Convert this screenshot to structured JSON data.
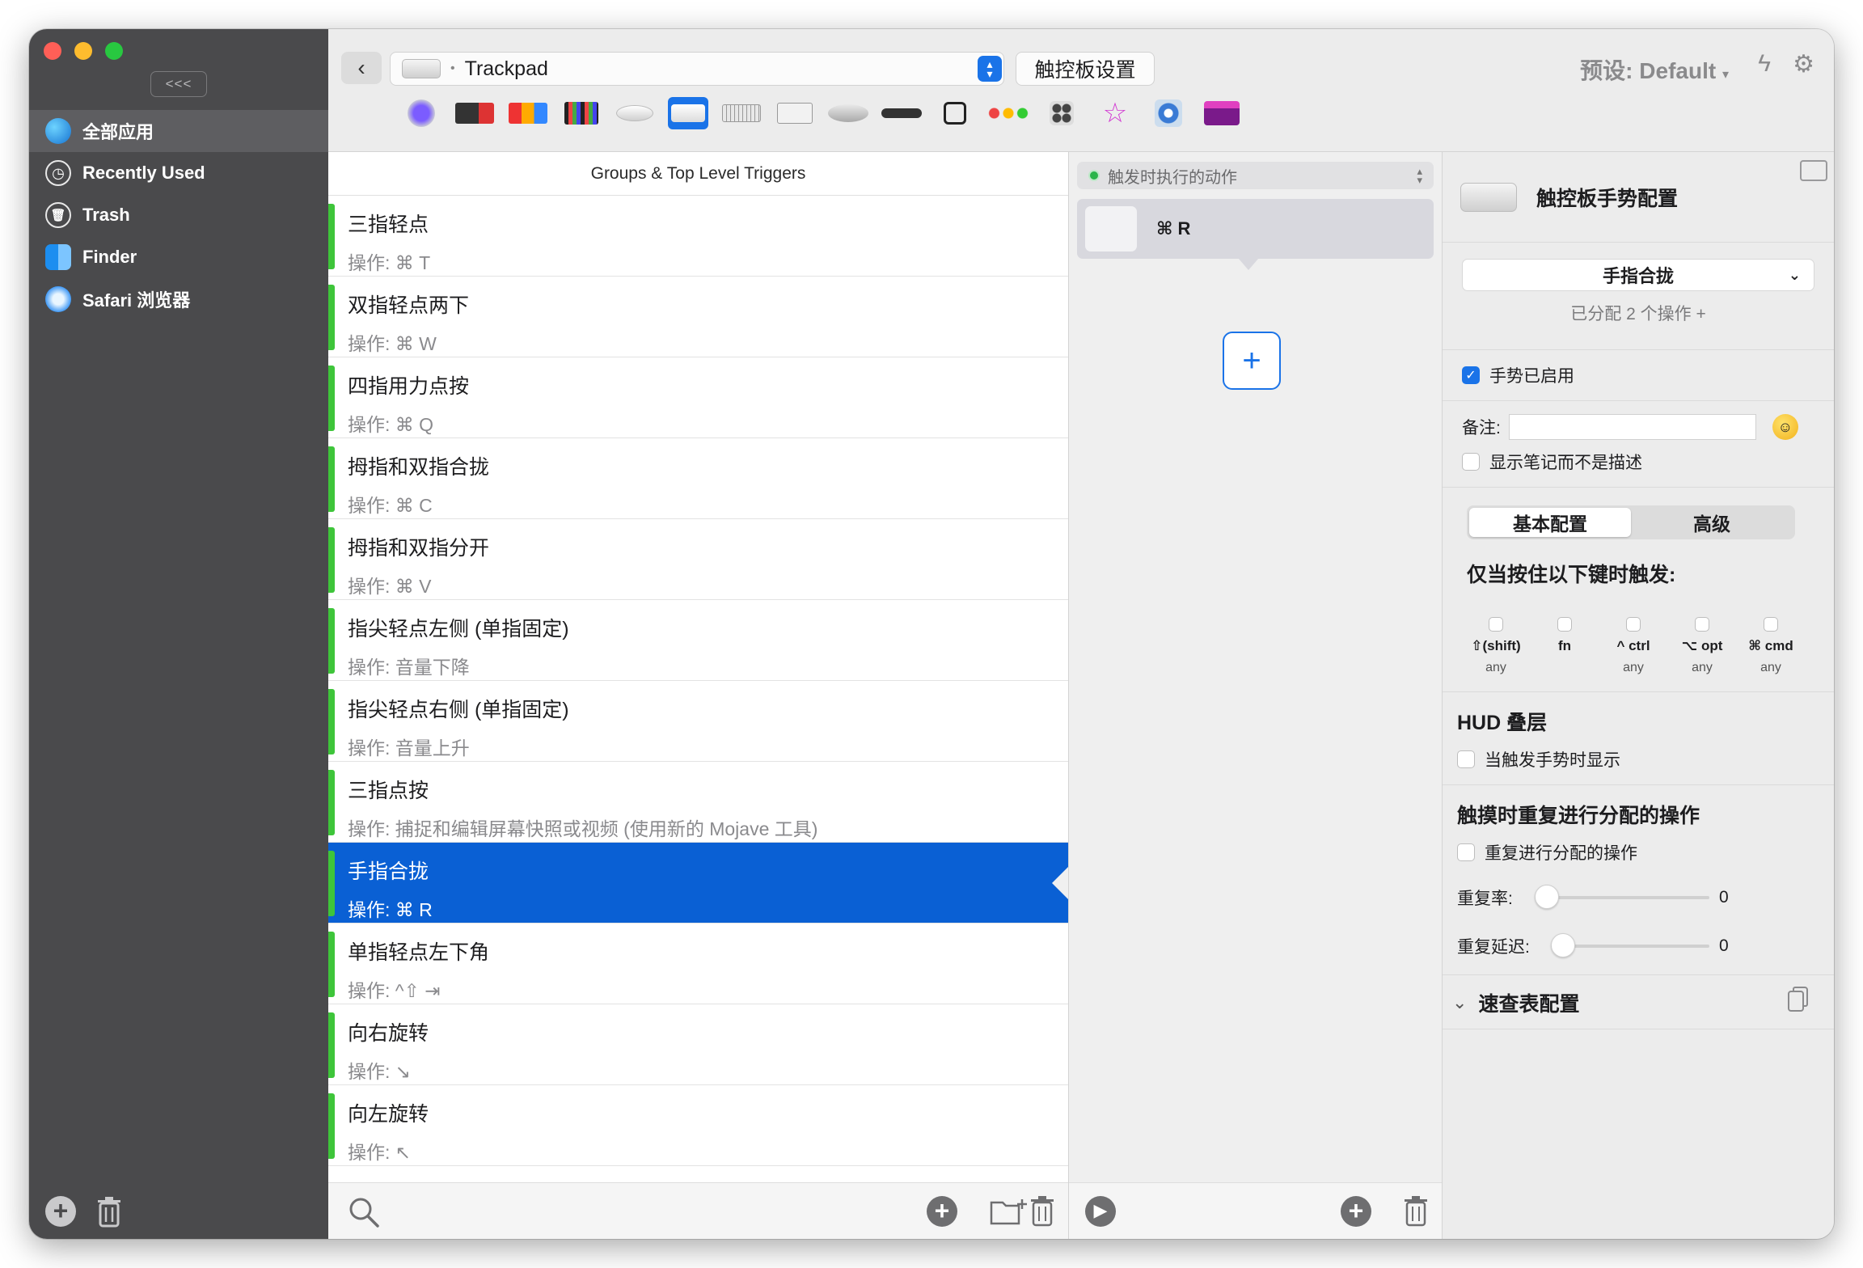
{
  "sidebar": {
    "collapse_label": "<<<",
    "items": [
      {
        "label": "全部应用",
        "icon": "globe-icon"
      },
      {
        "label": "Recently Used",
        "icon": "clock-icon"
      },
      {
        "label": "Trash",
        "icon": "trash-icon"
      },
      {
        "label": "Finder",
        "icon": "finder-icon"
      },
      {
        "label": "Safari 浏览器",
        "icon": "safari-icon"
      }
    ]
  },
  "toolbar": {
    "device_name": "Trackpad",
    "settings_button": "触控板设置",
    "preset_label": "预设: Default"
  },
  "list": {
    "header": "Groups & Top Level Triggers",
    "triggers": [
      {
        "title": "三指轻点",
        "sub": "操作: ⌘ T"
      },
      {
        "title": "双指轻点两下",
        "sub": "操作: ⌘ W"
      },
      {
        "title": "四指用力点按",
        "sub": "操作: ⌘ Q"
      },
      {
        "title": "拇指和双指合拢",
        "sub": "操作: ⌘ C"
      },
      {
        "title": "拇指和双指分开",
        "sub": "操作: ⌘ V"
      },
      {
        "title": "指尖轻点左侧 (单指固定)",
        "sub": "操作: 音量下降"
      },
      {
        "title": "指尖轻点右侧 (单指固定)",
        "sub": "操作: 音量上升"
      },
      {
        "title": "三指点按",
        "sub": "操作: 捕捉和编辑屏幕快照或视频 (使用新的 Mojave 工具)"
      },
      {
        "title": "手指合拢",
        "sub": "操作: ⌘ R"
      },
      {
        "title": "单指轻点左下角",
        "sub": "操作: ^⇧ ⇥"
      },
      {
        "title": "向右旋转",
        "sub": "操作: ↘"
      },
      {
        "title": "向左旋转",
        "sub": "操作: ↖"
      }
    ]
  },
  "actions": {
    "select_label": "触发时执行的动作",
    "item_label": "⌘ R",
    "add_label": "+"
  },
  "config": {
    "title": "触控板手势配置",
    "gesture": "手指合拢",
    "assigned": "已分配 2 个操作 +",
    "enabled_label": "手势已启用",
    "note_label": "备注:",
    "note_value": "",
    "show_note_label": "显示笔记而不是描述",
    "tab_basic": "基本配置",
    "tab_advanced": "高级",
    "modifiers_title": "仅当按住以下键时触发:",
    "modifiers": [
      {
        "label": "⇧(shift)",
        "any": "any"
      },
      {
        "label": "fn",
        "any": ""
      },
      {
        "label": "^ ctrl",
        "any": "any"
      },
      {
        "label": "⌥ opt",
        "any": "any"
      },
      {
        "label": "⌘ cmd",
        "any": "any"
      }
    ],
    "hud_title": "HUD 叠层",
    "hud_check": "当触发手势时显示",
    "repeat_title": "触摸时重复进行分配的操作",
    "repeat_check": "重复进行分配的操作",
    "rate_label": "重复率:",
    "rate_value": "0",
    "delay_label": "重复延迟:",
    "delay_value": "0",
    "cheatsheet_title": "速查表配置"
  },
  "colors": {
    "accent": "#1a73e8",
    "selection": "#0a60d4",
    "trigger_bar": "#3ec53a",
    "sidebar": "#4a4a4c"
  }
}
